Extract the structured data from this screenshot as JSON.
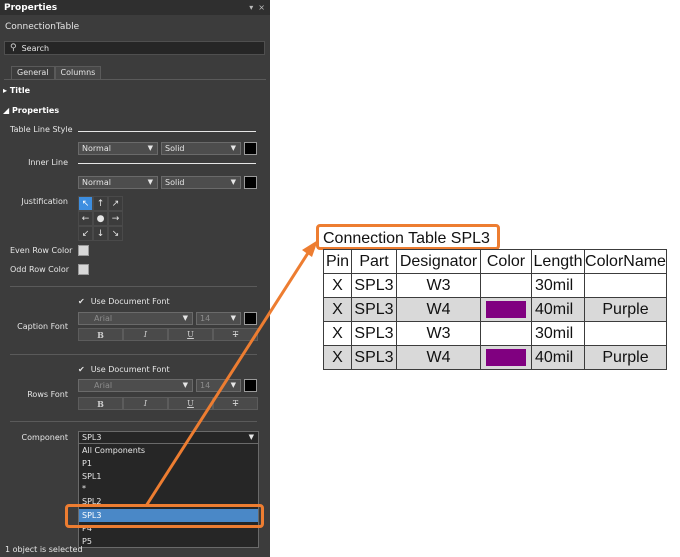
{
  "panel": {
    "title": "Properties",
    "pin_icon": "▾",
    "close_icon": "×",
    "object_name": "ConnectionTable",
    "search_placeholder": "Search",
    "tabs": [
      "General",
      "Columns"
    ],
    "title_section": "Title",
    "properties_section": "Properties",
    "table_line_style_label": "Table Line Style",
    "inner_line_label": "Inner Line",
    "outer_line_width": "Normal",
    "outer_line_style": "Solid",
    "inner_line_width": "Normal",
    "inner_line_style": "Solid",
    "justification_label": "Justification",
    "justification_arrows": [
      "↖",
      "↑",
      "↗",
      "←",
      "●",
      "→",
      "↙",
      "↓",
      "↘"
    ],
    "even_row_color_label": "Even Row Color",
    "odd_row_color_label": "Odd Row Color",
    "caption_font": {
      "label": "Caption Font",
      "use_document_font": "Use Document Font",
      "font_name": "Arial",
      "font_size": "14",
      "style_buttons": [
        "B",
        "I",
        "U",
        "T"
      ]
    },
    "rows_font": {
      "label": "Rows Font",
      "use_document_font": "Use Document Font",
      "font_name": "Arial",
      "font_size": "14",
      "style_buttons": [
        "B",
        "I",
        "U",
        "T"
      ]
    },
    "component": {
      "label": "Component",
      "selected": "SPL3",
      "options": [
        "All Components",
        "P1",
        "SPL1",
        "*",
        "SPL2",
        "SPL3",
        "P4",
        "P5"
      ]
    },
    "status": "1 object is selected"
  },
  "table": {
    "caption": "Connection Table SPL3",
    "headers": [
      "Pin",
      "Part",
      "Designator",
      "Color",
      "Length",
      "ColorName"
    ],
    "rows": [
      {
        "pin": "X",
        "part": "SPL3",
        "designator": "W3",
        "color": "",
        "length": "30mil",
        "colorname": ""
      },
      {
        "pin": "X",
        "part": "SPL3",
        "designator": "W4",
        "color": "#800080",
        "length": "40mil",
        "colorname": "Purple"
      },
      {
        "pin": "X",
        "part": "SPL3",
        "designator": "W3",
        "color": "",
        "length": "30mil",
        "colorname": ""
      },
      {
        "pin": "X",
        "part": "SPL3",
        "designator": "W4",
        "color": "#800080",
        "length": "40mil",
        "colorname": "Purple"
      }
    ]
  },
  "colors": {
    "panel_bg": "#3c3c3c",
    "accent_orange": "#ed7d31",
    "selection_blue": "#4a88c7",
    "wire_purple": "#800080",
    "even_row": "#d9d9d9"
  }
}
